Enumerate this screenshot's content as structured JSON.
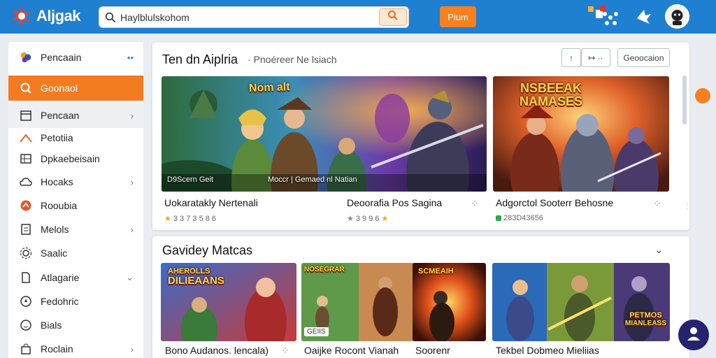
{
  "app": {
    "name": "Aljgak"
  },
  "search": {
    "value": "Haylblulskohom"
  },
  "topbar": {
    "cta_label": "Pium"
  },
  "sidebar": {
    "items": [
      {
        "label": "Pencaain",
        "icon": "puzzle-icon"
      },
      {
        "label": "Goonaol",
        "icon": "search-icon"
      },
      {
        "label": "Pencaan",
        "icon": "calendar-icon"
      },
      {
        "label": "Petotiia",
        "icon": "mountain-icon"
      },
      {
        "label": "Dpkaebeisain",
        "icon": "grid-icon"
      },
      {
        "label": "Hocaks",
        "icon": "cloud-icon"
      },
      {
        "label": "Rooubia",
        "icon": "badge-icon"
      },
      {
        "label": "Melols",
        "icon": "document-icon"
      },
      {
        "label": "Saalic",
        "icon": "gear-icon"
      },
      {
        "label": "Atlagarie",
        "icon": "file-icon"
      },
      {
        "label": "Fedohric",
        "icon": "compass-icon"
      },
      {
        "label": "Bials",
        "icon": "smile-icon"
      },
      {
        "label": "Roclain",
        "icon": "bag-icon"
      }
    ]
  },
  "section1": {
    "title": "Ten dn Aiplria",
    "subtitle": "Pnoéreer Ne lsiach",
    "button_label": "Geoocaion",
    "cards": [
      {
        "banner_left": "D9Scern Geit",
        "banner_right": "Moccr | Gemaed nl Natian",
        "title_left": "Uokaratakly Nertenali",
        "title_right": "Deoorafia Pos Sagina",
        "meta": "3 3 7 3 5 8 6",
        "meta2": "3 9 9 6"
      },
      {
        "art_title_1": "NSBEEAK",
        "art_title_2": "NAMASES",
        "title": "Adgorctol Sooterr Behosne",
        "meta": "283D43656"
      }
    ]
  },
  "section2": {
    "title": "Gavidey Matcas",
    "cards": [
      {
        "art_title_1": "AHEROLLS",
        "art_title_2": "DILIEAANS",
        "title": "Bono Audanos. lencala)"
      },
      {
        "art_title_1": "NOSEGRAR",
        "badge": "GEIIS",
        "title": "Oaijke Rocont  Vianah"
      },
      {
        "art_title_1": "SCMEAIH",
        "title": "Soorenr"
      },
      {
        "art_title_1": "PETMOS",
        "art_title_2": "MIANLEASS",
        "title": "Tekbel Dobmeo Mieliias"
      }
    ]
  },
  "colors": {
    "brand": "#1f7fd0",
    "accent": "#f7801f",
    "fab": "#23236e"
  }
}
